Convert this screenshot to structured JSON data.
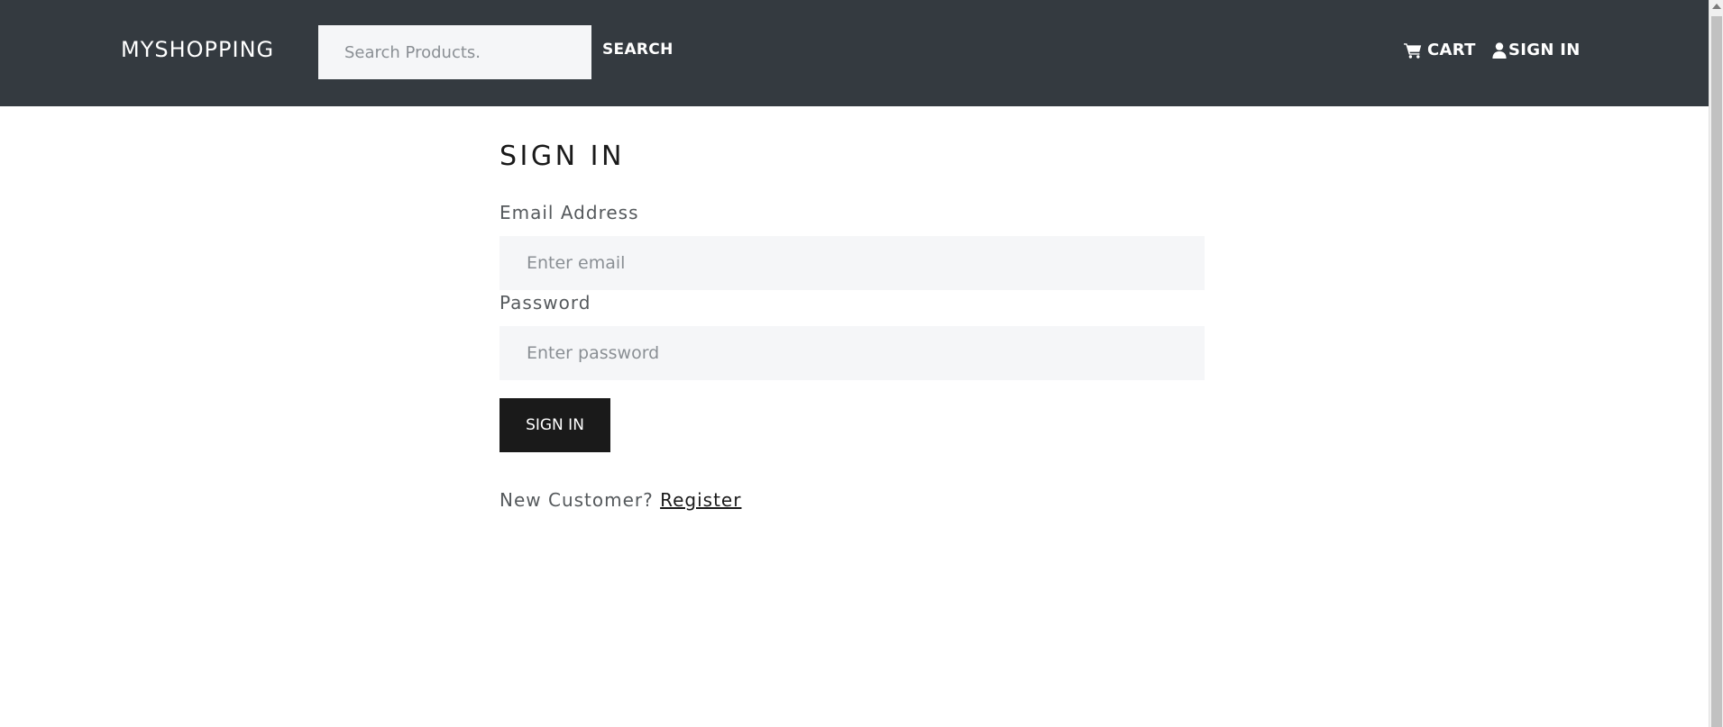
{
  "header": {
    "brand": "MYSHOPPING",
    "search_placeholder": "Search Products.",
    "search_button": "SEARCH",
    "cart_label": "CART",
    "signin_label": "SIGN IN",
    "cart_icon": "shopping-cart-icon",
    "user_icon": "user-icon"
  },
  "form": {
    "title": "SIGN IN",
    "email_label": "Email Address",
    "email_placeholder": "Enter email",
    "password_label": "Password",
    "password_placeholder": "Enter password",
    "submit_label": "SIGN IN",
    "new_customer_text": "New Customer?",
    "register_link": "Register"
  },
  "colors": {
    "navbar_bg": "#343a40",
    "input_bg": "#f5f6f8",
    "primary_button": "#1a1a1a"
  }
}
